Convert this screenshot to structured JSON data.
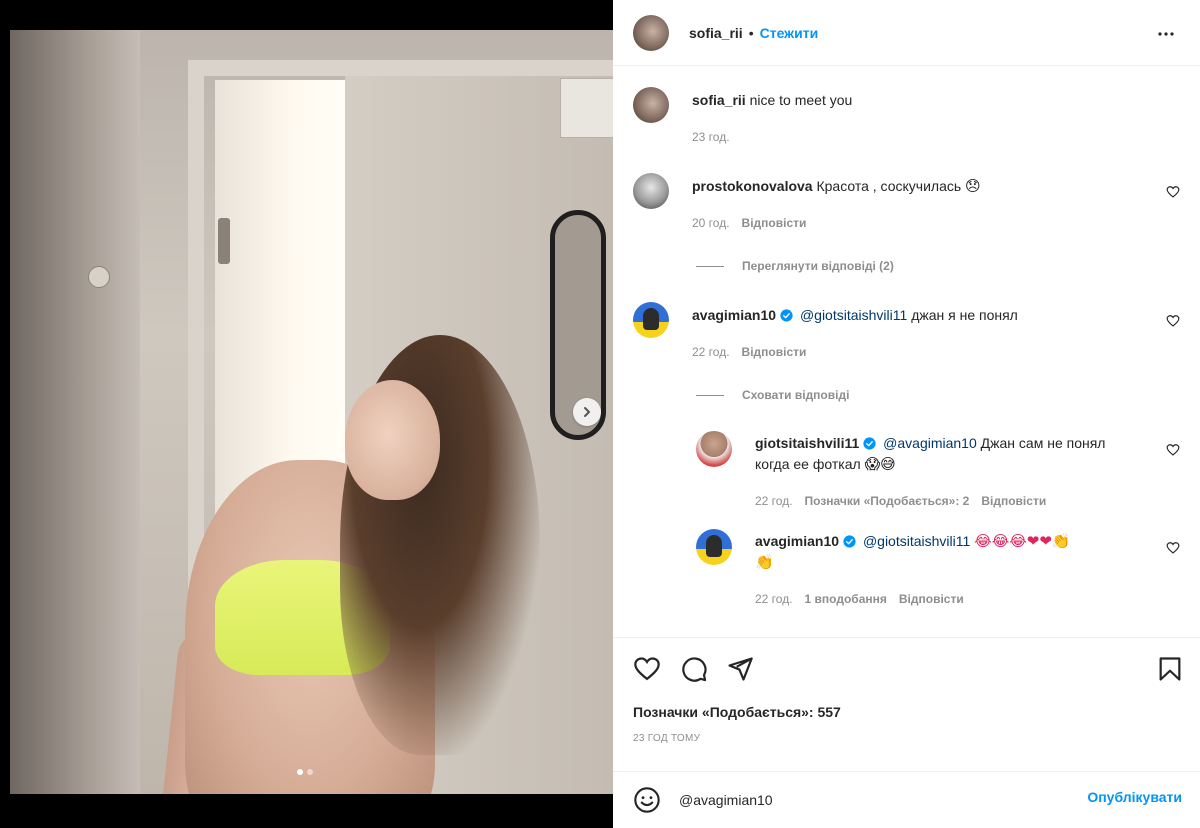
{
  "post": {
    "author": "sofia_rii",
    "separator": "•",
    "follow_label": "Стежити",
    "carousel": {
      "current_index": 1,
      "total": 2
    }
  },
  "caption": {
    "user": "sofia_rii",
    "text": "nice to meet you",
    "time": "23 год."
  },
  "comments": [
    {
      "user": "prostokonovalova",
      "text": "Красота , соскучилась",
      "emoji": "😞",
      "time": "20 год.",
      "reply_label": "Відповісти",
      "view_replies": "Переглянути відповіді (2)"
    },
    {
      "user": "avagimian10",
      "verified": true,
      "mention": "@giotsitaishvili11",
      "text": "джан я не понял",
      "time": "22 год.",
      "reply_label": "Відповісти",
      "hide_replies": "Сховати відповіді",
      "replies": [
        {
          "user": "giotsitaishvili11",
          "verified": true,
          "mention": "@avagimian10",
          "text_line1": "Джан сам не понял",
          "text_line2": "когда ее фоткал",
          "emoji": "😱😅",
          "time": "22 год.",
          "likes_label": "Позначки «Подобається»: 2",
          "reply_label": "Відповісти"
        },
        {
          "user": "avagimian10",
          "verified": true,
          "mention": "@giotsitaishvili11",
          "emoji_line1": "😂😂😂❤❤👏",
          "emoji_line2": "👏",
          "time": "22 год.",
          "likes_label": "1 вподобання",
          "reply_label": "Відповісти"
        }
      ]
    }
  ],
  "footer": {
    "likes_text": "Позначки «Подобається»: 557",
    "time_ago": "23 ГОД ТОМУ",
    "comment_value": "@avagimian10",
    "publish_label": "Опублікувати"
  },
  "icons": {
    "more": "more-horizontal-icon",
    "like": "heart-icon",
    "comment": "comment-icon",
    "share": "send-icon",
    "save": "bookmark-icon",
    "emoji": "smiley-icon",
    "verified": "verified-badge-icon",
    "next": "chevron-right-icon"
  },
  "colors": {
    "accent": "#0095f6",
    "mention": "#00376b",
    "muted": "#8e8e8e",
    "text": "#262626"
  }
}
